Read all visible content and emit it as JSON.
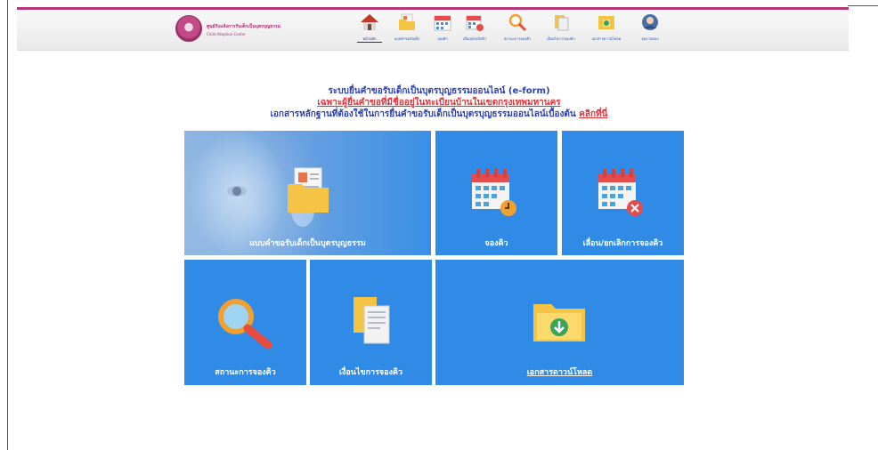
{
  "header": {
    "org_name_th": "ศูนย์รับแจ้งการรับเด็กเป็นบุตรบุญธรรม",
    "org_name_en": "Child Adoption Center",
    "logo_icon": "seal-logo-icon",
    "nav": [
      {
        "label": "หน้าหลัก",
        "icon": "home-icon",
        "active": true
      },
      {
        "label": "แบบคำขอรับเด็ก",
        "icon": "document-folder-icon"
      },
      {
        "label": "จองคิว",
        "icon": "calendar-icon"
      },
      {
        "label": "เลื่อน/ยกเลิกคิว",
        "icon": "calendar-cancel-icon"
      },
      {
        "label": "สถานะการจองคิว",
        "icon": "search-icon"
      },
      {
        "label": "เงื่อนไขการจองคิว",
        "icon": "papers-icon"
      },
      {
        "label": "เอกสารดาวน์โหลด",
        "icon": "download-folder-icon"
      },
      {
        "label": "ผลงานของ",
        "icon": "user-icon"
      }
    ]
  },
  "intro": {
    "title": "ระบบยื่นคำขอรับเด็กเป็นบุตรบุญธรรมออนไลน์ (e-form)",
    "notice": "เฉพาะผู้ยื่นคำขอที่มีชื่ออยู่ในทะเบียนบ้านในเขตกรุงเทพมหานคร",
    "docs_text": "เอกสารหลักฐานที่ต้องใช้ในการยื่นคำขอรับเด็กเป็นบุตรบุญธรรมออนไลน์เบื้องต้น",
    "docs_link": "คลิกที่นี่"
  },
  "tiles": {
    "form": "แบบคำขอรับเด็กเป็นบุตรบุญธรรม",
    "book": "จองคิว",
    "reschedule": "เลื่อน/ยกเลิกการจองคิว",
    "status": "สถานะการจองคิว",
    "conditions": "เงื่อนไขการจองคิว",
    "download": "เอกสารดาวน์โหลด"
  },
  "colors": {
    "tile_blue": "#2f8be6",
    "brand_pink": "#b5377a",
    "title_blue": "#2b3fb5",
    "notice_red": "#e0343c"
  }
}
